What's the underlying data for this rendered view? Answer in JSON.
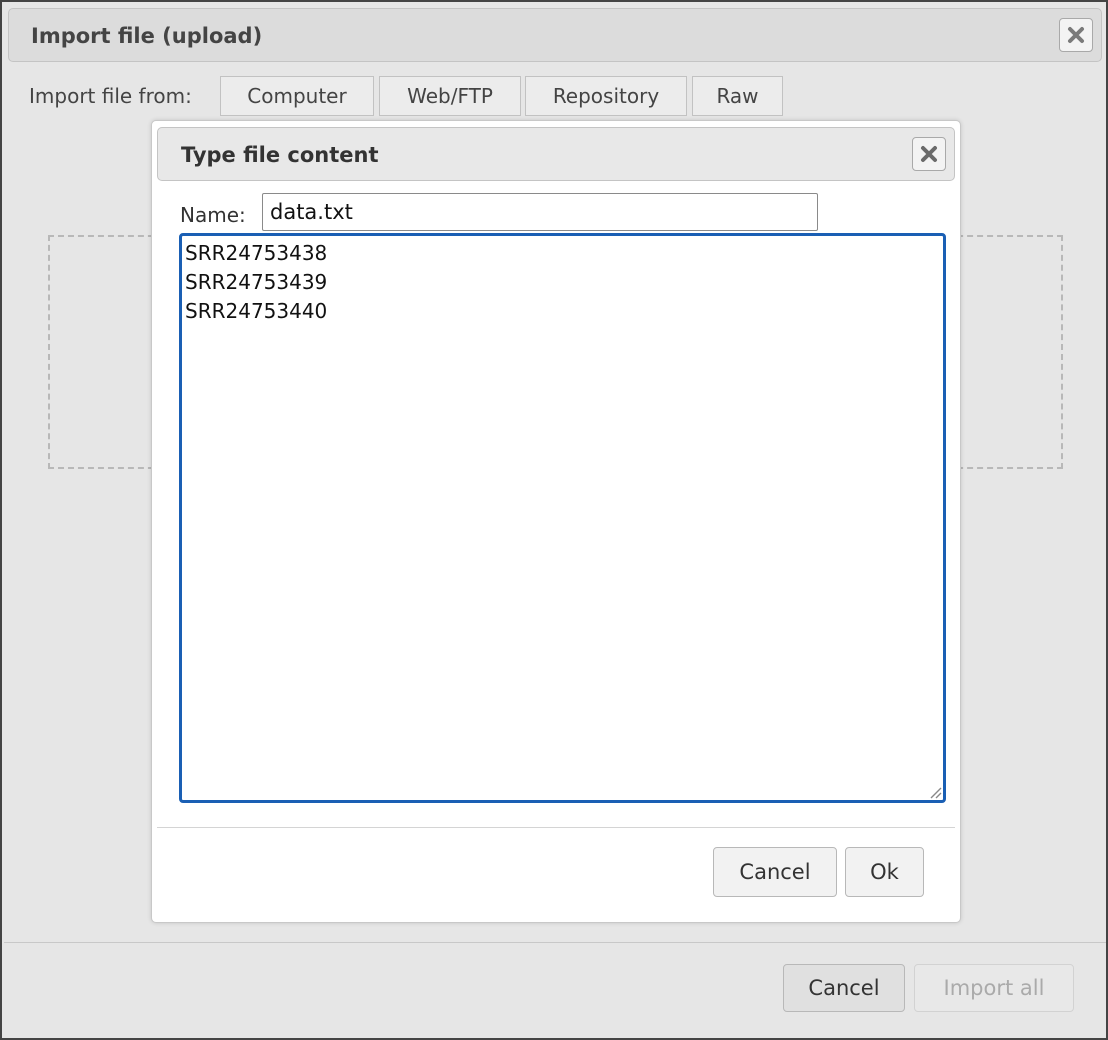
{
  "outer_dialog": {
    "title": "Import file (upload)",
    "import_from_label": "Import file from:",
    "tabs": [
      {
        "label": "Computer"
      },
      {
        "label": "Web/FTP"
      },
      {
        "label": "Repository"
      },
      {
        "label": "Raw"
      }
    ],
    "footer": {
      "cancel_label": "Cancel",
      "import_all_label": "Import all"
    }
  },
  "inner_dialog": {
    "title": "Type file content",
    "name_label": "Name:",
    "name_value": "data.txt",
    "content_value": "SRR24753438\nSRR24753439\nSRR24753440",
    "cancel_label": "Cancel",
    "ok_label": "Ok"
  },
  "colors": {
    "focus_border": "#1a5fb4",
    "backdrop": "#e6e6e6",
    "disabled_text": "#aaaaaa"
  },
  "icons": {
    "close": "close-icon",
    "resize": "resize-grip-icon"
  }
}
